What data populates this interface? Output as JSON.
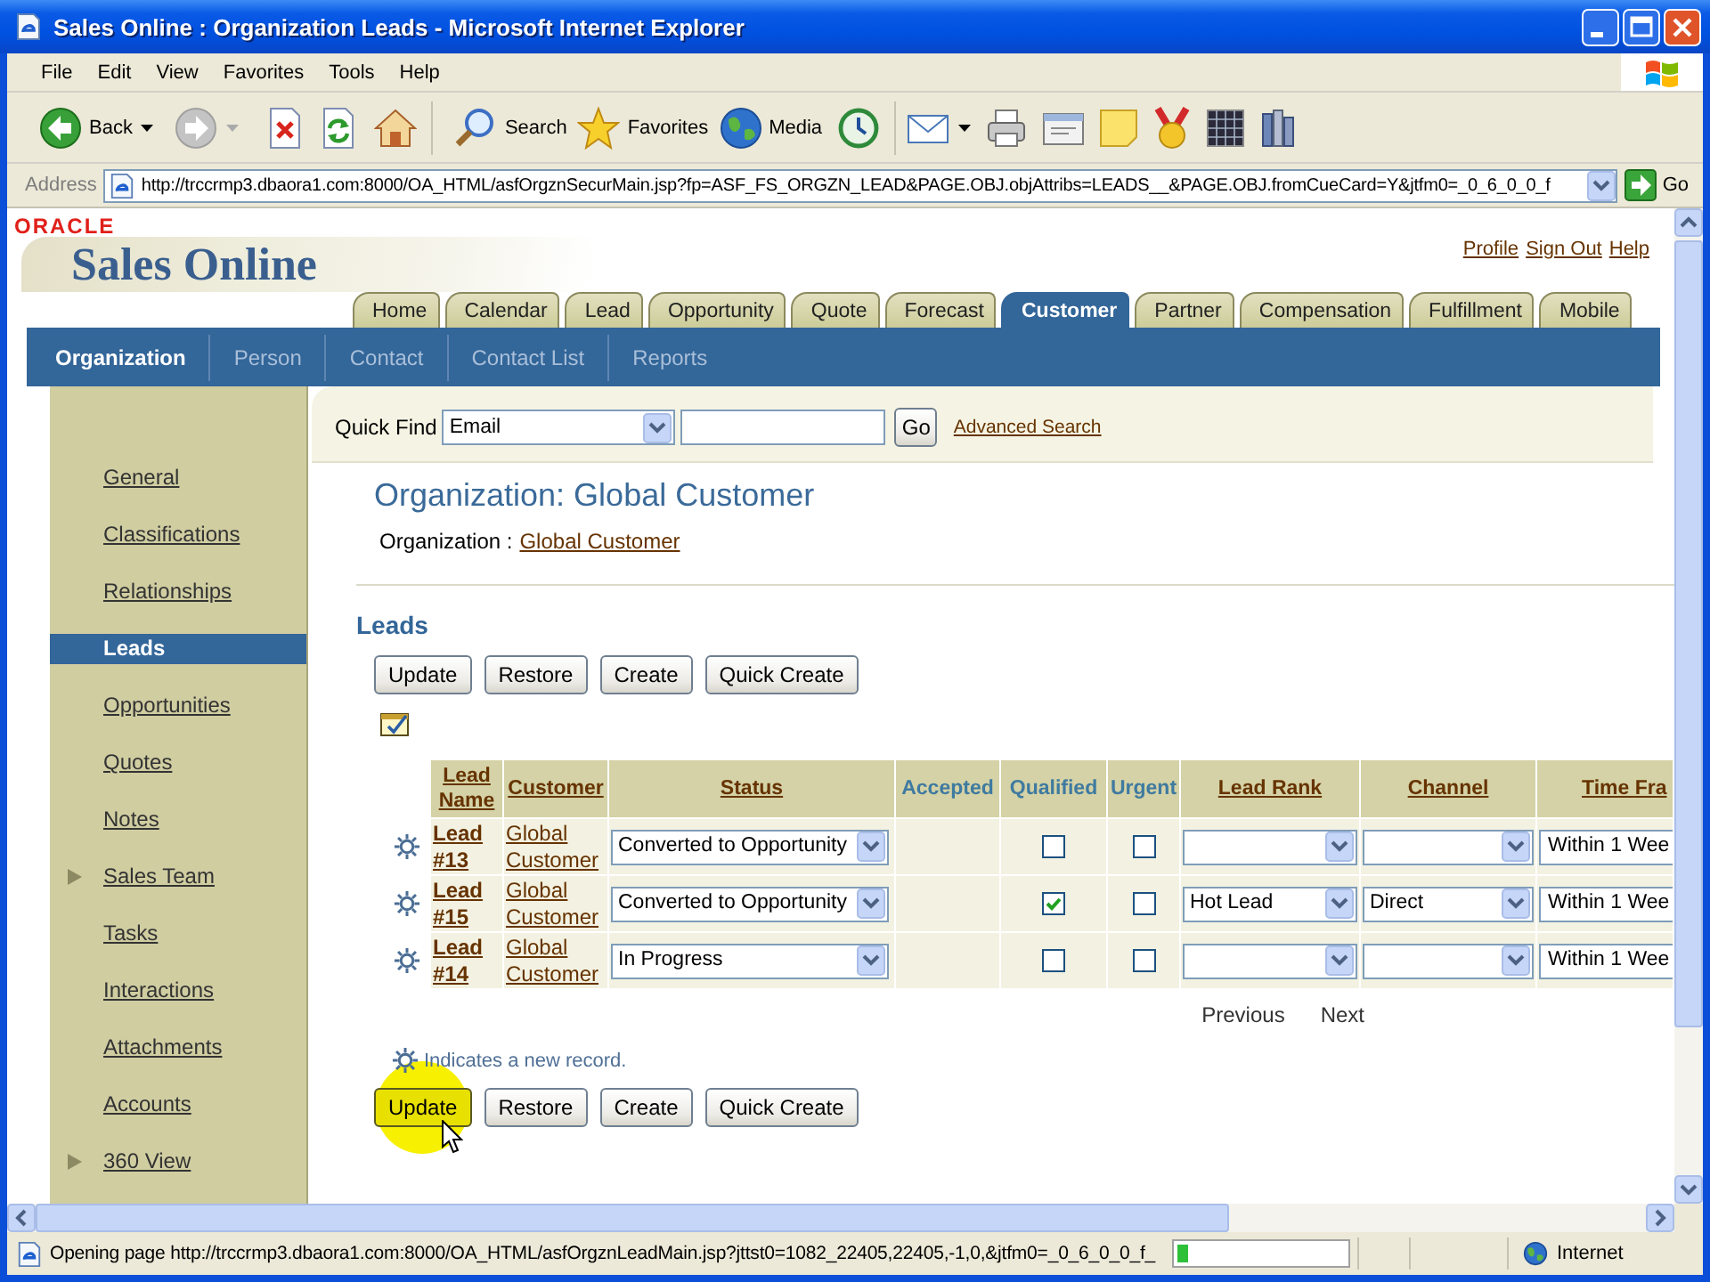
{
  "window": {
    "title": "Sales Online : Organization Leads - Microsoft Internet Explorer"
  },
  "menu_bar": [
    "File",
    "Edit",
    "View",
    "Favorites",
    "Tools",
    "Help"
  ],
  "toolbar": {
    "back": {
      "label": "Back",
      "disabled": false
    },
    "forward": {
      "disabled": true
    },
    "search": "Search",
    "favorites": "Favorites",
    "media": "Media"
  },
  "address_bar": {
    "label": "Address",
    "url": "http://trccrmp3.dbaora1.com:8000/OA_HTML/asfOrgznSecurMain.jsp?fp=ASF_FS_ORGZN_LEAD&PAGE.OBJ.objAttribs=LEADS__&PAGE.OBJ.fromCueCard=Y&jtfm0=_0_6_0_0_f",
    "go": "Go"
  },
  "header": {
    "brand": "ORACLE",
    "app_name": "Sales Online",
    "links": [
      "Profile",
      "Sign Out",
      "Help"
    ]
  },
  "tabs": [
    {
      "label": "Home",
      "selected": false
    },
    {
      "label": "Calendar",
      "selected": false
    },
    {
      "label": "Lead",
      "selected": false
    },
    {
      "label": "Opportunity",
      "selected": false
    },
    {
      "label": "Quote",
      "selected": false
    },
    {
      "label": "Forecast",
      "selected": false
    },
    {
      "label": "Customer",
      "selected": true
    },
    {
      "label": "Partner",
      "selected": false
    },
    {
      "label": "Compensation",
      "selected": false
    },
    {
      "label": "Fulfillment",
      "selected": false
    },
    {
      "label": "Mobile",
      "selected": false
    }
  ],
  "subtabs": [
    {
      "label": "Organization",
      "selected": true
    },
    {
      "label": "Person",
      "selected": false
    },
    {
      "label": "Contact",
      "selected": false
    },
    {
      "label": "Contact List",
      "selected": false
    },
    {
      "label": "Reports",
      "selected": false
    }
  ],
  "sidebar": {
    "items": [
      {
        "label": "General",
        "selected": false,
        "expandable": false
      },
      {
        "label": "Classifications",
        "selected": false,
        "expandable": false
      },
      {
        "label": "Relationships",
        "selected": false,
        "expandable": false
      },
      {
        "label": "Leads",
        "selected": true,
        "expandable": false
      },
      {
        "label": "Opportunities",
        "selected": false,
        "expandable": false
      },
      {
        "label": "Quotes",
        "selected": false,
        "expandable": false
      },
      {
        "label": "Notes",
        "selected": false,
        "expandable": false
      },
      {
        "label": "Sales Team",
        "selected": false,
        "expandable": true
      },
      {
        "label": "Tasks",
        "selected": false,
        "expandable": false
      },
      {
        "label": "Interactions",
        "selected": false,
        "expandable": false
      },
      {
        "label": "Attachments",
        "selected": false,
        "expandable": false
      },
      {
        "label": "Accounts",
        "selected": false,
        "expandable": false
      },
      {
        "label": "360 View",
        "selected": false,
        "expandable": true
      }
    ]
  },
  "quick_find": {
    "label": "Quick Find",
    "field": "Email",
    "button": "Go",
    "link": "Advanced Search"
  },
  "page_title": "Organization: Global Customer",
  "organization": {
    "label": "Organization :",
    "value": "Global Customer"
  },
  "leads": {
    "title": "Leads",
    "buttons": [
      "Update",
      "Restore",
      "Create",
      "Quick Create"
    ],
    "columns": [
      {
        "label": "Lead Name",
        "sortable": true
      },
      {
        "label": "Customer",
        "sortable": true
      },
      {
        "label": "Status",
        "sortable": true
      },
      {
        "label": "Accepted",
        "sortable": false
      },
      {
        "label": "Qualified",
        "sortable": false
      },
      {
        "label": "Urgent",
        "sortable": false
      },
      {
        "label": "Lead Rank",
        "sortable": true
      },
      {
        "label": "Channel",
        "sortable": true
      },
      {
        "label": "Time Fra",
        "sortable": true
      }
    ],
    "rows": [
      {
        "new_record": true,
        "lead": "Lead #13",
        "customer": "Global Customer",
        "status": "Converted to Opportunity",
        "qualified": false,
        "urgent": false,
        "time_frame": "Within 1 Wee"
      },
      {
        "new_record": true,
        "lead": "Lead #15",
        "customer": "Global Customer",
        "status": "Converted to Opportunity",
        "qualified": true,
        "urgent": false,
        "lead_rank": "Hot Lead",
        "channel": "Direct",
        "time_frame": "Within 1 Wee"
      },
      {
        "new_record": true,
        "lead": "Lead #14",
        "customer": "Global Customer",
        "status": "In Progress",
        "qualified": false,
        "urgent": false,
        "time_frame": "Within 1 Wee"
      }
    ],
    "pagination": [
      "Previous",
      "Next"
    ],
    "legend": "Indicates a new record.",
    "bottom_buttons": [
      {
        "label": "Update",
        "highlighted": true
      },
      {
        "label": "Restore",
        "highlighted": false
      },
      {
        "label": "Create",
        "highlighted": false
      },
      {
        "label": "Quick Create",
        "highlighted": false
      }
    ]
  },
  "status_bar": {
    "message": "Opening page http://trccrmp3.dbaora1.com:8000/OA_HTML/asfOrgznLeadMain.jsp?jttst0=1082_22405,22405,-1,0,&jtfm0=_0_6_0_0_f_",
    "progress": {
      "level": 0.06
    },
    "zone": "Internet"
  }
}
